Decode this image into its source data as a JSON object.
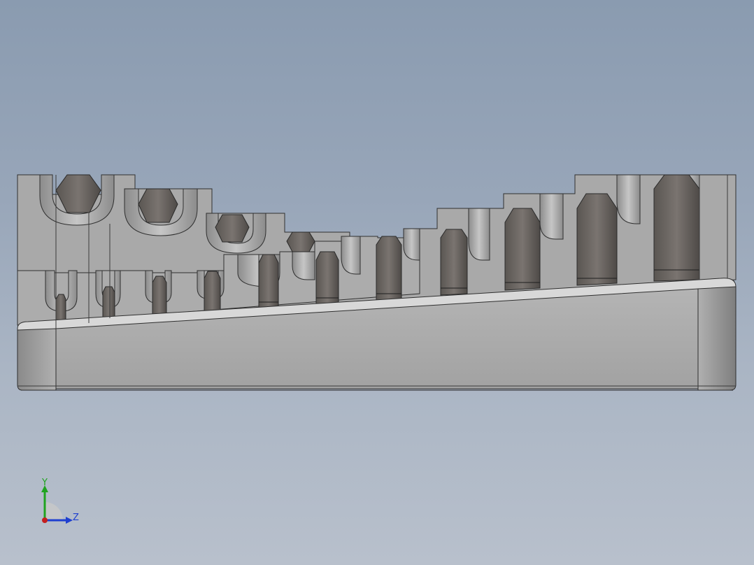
{
  "viewport": {
    "background_top": "#8a9bb0",
    "background_bottom": "#b8c0cc"
  },
  "model": {
    "body_color": "#a7a7a7",
    "bit_color": "#6e6a66",
    "edge_color": "#2f2f2f"
  },
  "triad": {
    "y_label": "Y",
    "z_label": "Z",
    "y_color": "#1fa31f",
    "z_color": "#1e3fd0",
    "x_color": "#c41f1f"
  }
}
